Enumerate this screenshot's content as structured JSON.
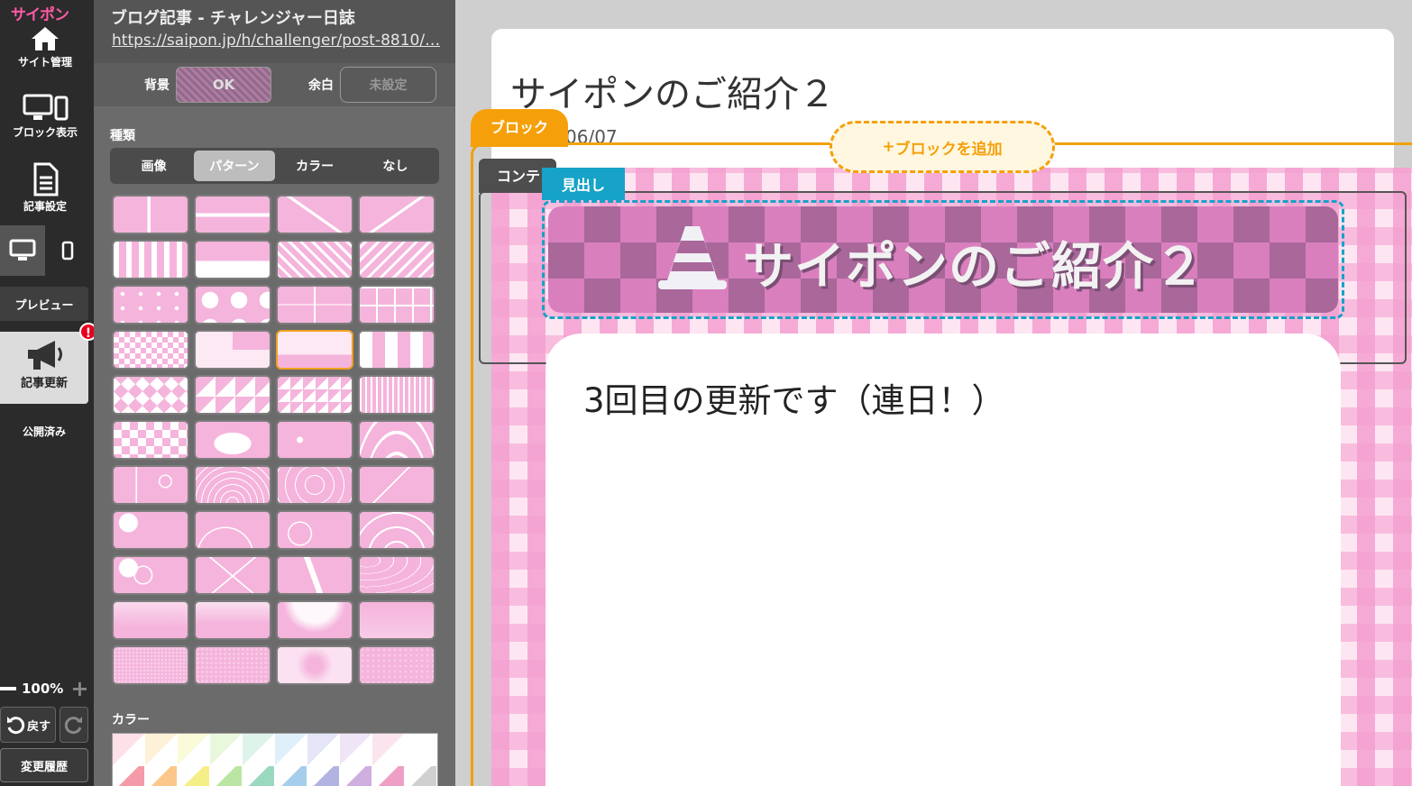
{
  "sidebar": {
    "logo": "サイポン",
    "site_manage": "サイト管理",
    "block_view": "ブロック表示",
    "article_settings": "記事設定",
    "preview": "プレビュー",
    "update": "記事更新",
    "alert": "!",
    "published": "公開済み",
    "zoom": "100%",
    "undo": "戻す",
    "history": "変更履歴"
  },
  "panel": {
    "title": "ブログ記事 - チャレンジャー日誌",
    "url": "https://saipon.jp/h/challenger/post-8810/…",
    "bg_label": "背景",
    "bg_value": "OK",
    "margin_label": "余白",
    "margin_value": "未設定",
    "type_label": "種類",
    "type_tabs": [
      "画像",
      "パターン",
      "カラー",
      "なし"
    ],
    "color_label": "カラー"
  },
  "preview": {
    "article_title": "サイポンのご紹介２",
    "date": "06/07",
    "block_tab": "ブロック",
    "add_block": "ブロックを追加",
    "content_tab": "コンテンツ",
    "heading_tab": "見出し",
    "heading_text": "サイポンのご紹介２",
    "body_text": "3回目の更新です（連日！）"
  },
  "colors": {
    "accent_orange": "#f5a00a",
    "accent_blue": "#17a2c8",
    "pattern_pink": "#f5b4dc",
    "sidebar_bg": "#2b2b2b",
    "panel_bg": "#6b6b6b"
  }
}
